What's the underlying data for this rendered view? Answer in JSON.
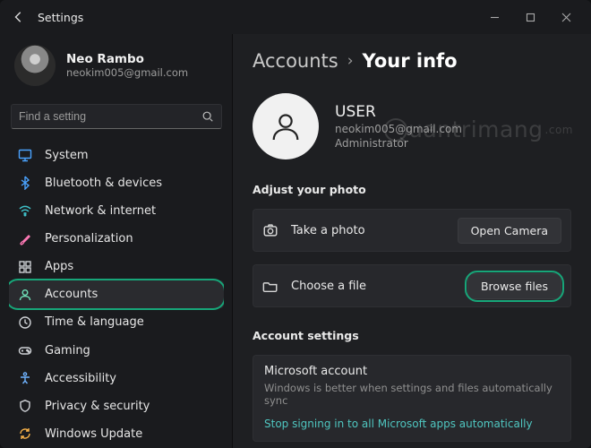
{
  "window": {
    "title": "Settings"
  },
  "user_sidebar": {
    "name": "Neo Rambo",
    "email": "neokim005@gmail.com"
  },
  "search": {
    "placeholder": "Find a setting"
  },
  "sidebar": {
    "items": [
      {
        "key": "system",
        "label": "System",
        "icon": "monitor",
        "color": "#4aa3ff"
      },
      {
        "key": "bluetooth",
        "label": "Bluetooth & devices",
        "icon": "bluetooth",
        "color": "#4aa3ff"
      },
      {
        "key": "network",
        "label": "Network & internet",
        "icon": "wifi",
        "color": "#3fc1c9"
      },
      {
        "key": "personalization",
        "label": "Personalization",
        "icon": "brush",
        "color": "#ff7ab6"
      },
      {
        "key": "apps",
        "label": "Apps",
        "icon": "grid",
        "color": "#cfd2d6"
      },
      {
        "key": "accounts",
        "label": "Accounts",
        "icon": "person",
        "color": "#6fe0b8",
        "selected": true,
        "highlighted": true
      },
      {
        "key": "time",
        "label": "Time & language",
        "icon": "clock",
        "color": "#cfd2d6"
      },
      {
        "key": "gaming",
        "label": "Gaming",
        "icon": "game",
        "color": "#cfd2d6"
      },
      {
        "key": "accessibility",
        "label": "Accessibility",
        "icon": "access",
        "color": "#6fb3ff"
      },
      {
        "key": "privacy",
        "label": "Privacy & security",
        "icon": "shield",
        "color": "#cfd2d6"
      },
      {
        "key": "update",
        "label": "Windows Update",
        "icon": "update",
        "color": "#ffb74a"
      }
    ]
  },
  "breadcrumb": {
    "root": "Accounts",
    "leaf": "Your info"
  },
  "account": {
    "display_name": "USER",
    "email": "neokim005@gmail.com",
    "role": "Administrator"
  },
  "photo_section": {
    "heading": "Adjust your photo",
    "take_photo": {
      "label": "Take a photo",
      "button": "Open Camera"
    },
    "choose_file": {
      "label": "Choose a file",
      "button": "Browse files",
      "highlighted": true
    }
  },
  "account_settings": {
    "heading": "Account settings",
    "ms_account": {
      "title": "Microsoft account",
      "desc": "Windows is better when settings and files automatically sync",
      "link": "Stop signing in to all Microsoft apps automatically"
    }
  },
  "watermark": "uantrimang"
}
